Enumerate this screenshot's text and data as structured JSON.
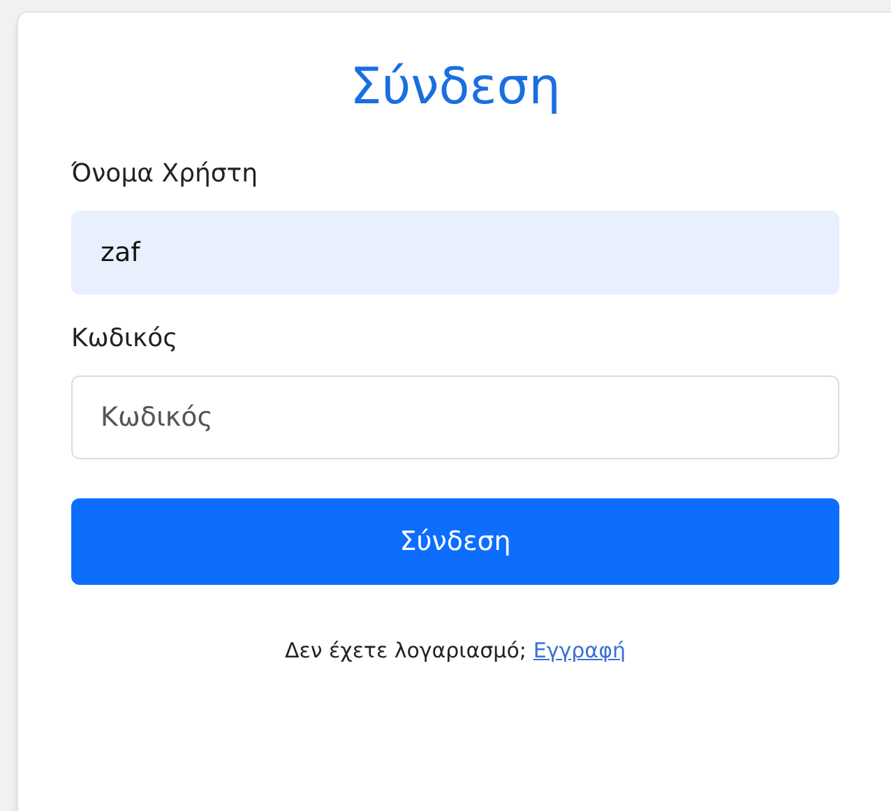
{
  "title": "Σύνδεση",
  "fields": [
    {
      "label": "Όνομα Χρήστη",
      "value": "zaf",
      "autofilled": true
    },
    {
      "label": "Κωδικός",
      "placeholder": "Κωδικός",
      "autofilled": false
    }
  ],
  "submit_button": "Σύνδεση",
  "footer": {
    "text": "Δεν έχετε λογαριασμό;",
    "link": "Εγγραφή"
  }
}
